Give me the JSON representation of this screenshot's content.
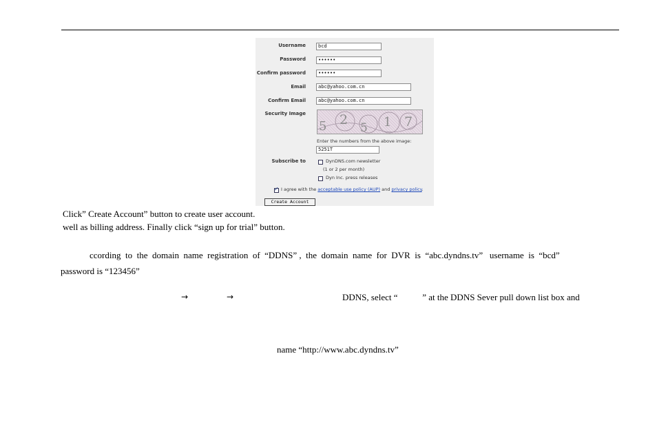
{
  "form": {
    "username_label": "Username",
    "username_value": "bcd",
    "password_label": "Password",
    "password_value": "••••••",
    "confirm_password_label": "Confirm password",
    "confirm_password_value": "••••••",
    "email_label": "Email",
    "email_value": "abc@yahoo.com.cn",
    "confirm_email_label": "Confirm Email",
    "confirm_email_value": "abc@yahoo.com.cn",
    "security_image_label": "Security Image",
    "captcha_chars": [
      "5",
      "2",
      "5",
      "1",
      "7"
    ],
    "captcha_hint": "Enter the numbers from the above image:",
    "captcha_value": "5251T",
    "subscribe_label": "Subscribe to",
    "newsletter_label": "DynDNS.com newsletter",
    "newsletter_note": "(1 or 2 per month)",
    "press_label": "Dyn Inc. press releases",
    "agree_prefix": "I agree with the",
    "aup_link": "acceptable use policy (AUP)",
    "agree_and": "and",
    "privacy_link": "privacy policy",
    "agree_suffix": ".",
    "create_button": "Create Account"
  },
  "doc": {
    "line1": "Click” Create Account” button to create user account.",
    "line2": "well as billing address. Finally click “sign up for trial” button.",
    "para_a": "ccording  to  the  domain  name  registration  of  “DDNS” ,  the  domain  name  for  DVR  is  “abc.dyndns.tv”   username  is  “bcd”",
    "para_b": "password is “123456”",
    "arrow1": "→",
    "arrow2": "→",
    "select_text": "DDNS, select “           ” at the DDNS Sever pull down list box and",
    "name_text": "name “http://www.abc.dyndns.tv”"
  }
}
